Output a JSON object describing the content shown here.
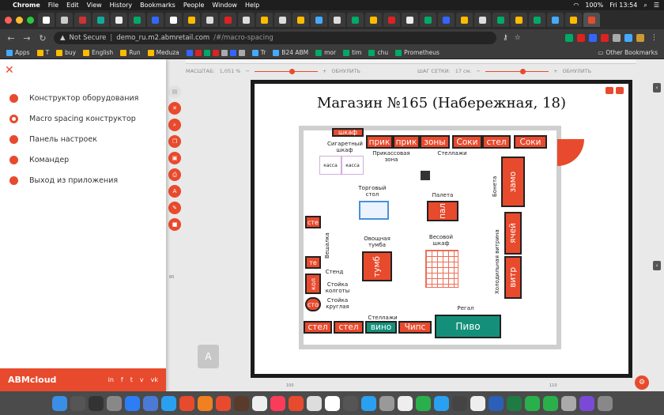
{
  "menubar": {
    "app": "Chrome",
    "items": [
      "File",
      "Edit",
      "View",
      "History",
      "Bookmarks",
      "People",
      "Window",
      "Help"
    ],
    "battery": "100%",
    "clock": "Fri 13:54"
  },
  "address": {
    "security": "Not Secure",
    "url_host": "demo_ru.m2.abmretail.com",
    "url_path": "/#/macro-spacing"
  },
  "bookmarks": {
    "items": [
      "Apps",
      "T",
      "buy",
      "English",
      "Run",
      "Meduza",
      "Tr",
      "B24 ABM",
      "mor",
      "tim",
      "chu",
      "Prometheus"
    ],
    "other": "Other Bookmarks"
  },
  "sidebar": {
    "items": [
      {
        "label": "Конструктор оборудования"
      },
      {
        "label": "Macro spacing конструктор"
      },
      {
        "label": "Панель настроек"
      },
      {
        "label": "Командер"
      },
      {
        "label": "Выход из приложения"
      }
    ],
    "logo": "ABMcloud",
    "social": [
      "in",
      "f",
      "t",
      "v",
      "vk"
    ]
  },
  "topbar": {
    "scale_label": "МАСШТАБ:",
    "scale_value": "1,051 %",
    "reset1": "ОБНУЛИТЬ",
    "grid_label": "ШАГ СЕТКИ:",
    "grid_value": "17 см.",
    "reset2": "ОБНУЛИТЬ"
  },
  "ruler": {
    "left_mark": "80",
    "bottom_left": "100",
    "bottom_right": "110"
  },
  "plan": {
    "title": "Магазин №165 (Набережная, 18)",
    "shelves_top": [
      "шкаф",
      "прик",
      "прик",
      "зоны",
      "Соки",
      "стел",
      "Соки"
    ],
    "labels": {
      "cig": "Сигаретный шкаф",
      "checkout_zone": "Прикассовая зона",
      "racks_top": "Стеллажи",
      "cash1": "касса",
      "cash2": "касса",
      "trade_table": "Торговый стол",
      "pallet": "Палета",
      "pallet_item": "пал",
      "bonetta": "Бонета",
      "freeze": "замо",
      "hanger": "Вешалка",
      "veg": "Овощная тумба",
      "veg_item": "тумб",
      "scale": "Весовой шкаф",
      "cold": "Холодильная витрина",
      "cold1": "ячей",
      "cold2": "витр",
      "stand": "Стенд",
      "rack_pole": "Стойка колготы",
      "rack_round": "Стойка круглая",
      "racks_bottom": "Стеллажи",
      "regal": "Регал",
      "beer": "Пиво",
      "left1": "сте",
      "left2": "те",
      "left3": "кол",
      "left4": "сто"
    },
    "shelves_bottom": [
      "стел",
      "стел",
      "вино",
      "Чипс"
    ]
  }
}
